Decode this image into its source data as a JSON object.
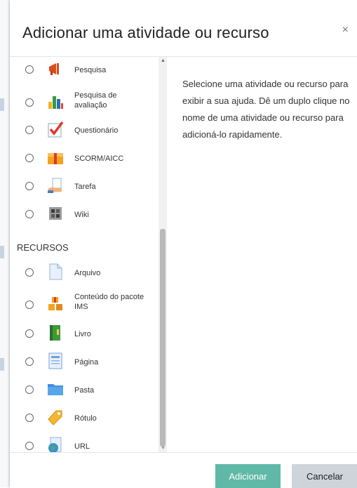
{
  "dialog": {
    "title": "Adicionar uma atividade ou recurso",
    "close_symbol": "×"
  },
  "activities": [
    {
      "label": "Pesquisa",
      "icon": "megaphone-icon"
    },
    {
      "label": "Pesquisa de avaliação",
      "icon": "bar-chart-icon"
    },
    {
      "label": "Questionário",
      "icon": "checkmark-icon"
    },
    {
      "label": "SCORM/AICC",
      "icon": "package-box-icon"
    },
    {
      "label": "Tarefa",
      "icon": "hand-paper-icon"
    },
    {
      "label": "Wiki",
      "icon": "wiki-icon"
    }
  ],
  "resources_heading": "RECURSOS",
  "resources": [
    {
      "label": "Arquivo",
      "icon": "file-icon"
    },
    {
      "label": "Conteúdo do pacote IMS",
      "icon": "ims-package-icon"
    },
    {
      "label": "Livro",
      "icon": "book-icon"
    },
    {
      "label": "Página",
      "icon": "page-icon"
    },
    {
      "label": "Pasta",
      "icon": "folder-icon"
    },
    {
      "label": "Rótulo",
      "icon": "tag-label-icon"
    },
    {
      "label": "URL",
      "icon": "globe-url-icon"
    }
  ],
  "help_text": "Selecione uma atividade ou recurso para exibir a sua ajuda. Dê um duplo clique no nome de uma atividade ou recurso para adicioná-lo rapidamente.",
  "footer": {
    "add_label": "Adicionar",
    "cancel_label": "Cancelar"
  },
  "colors": {
    "add_button": "#5fb9a6",
    "cancel_button": "#ced4da"
  }
}
